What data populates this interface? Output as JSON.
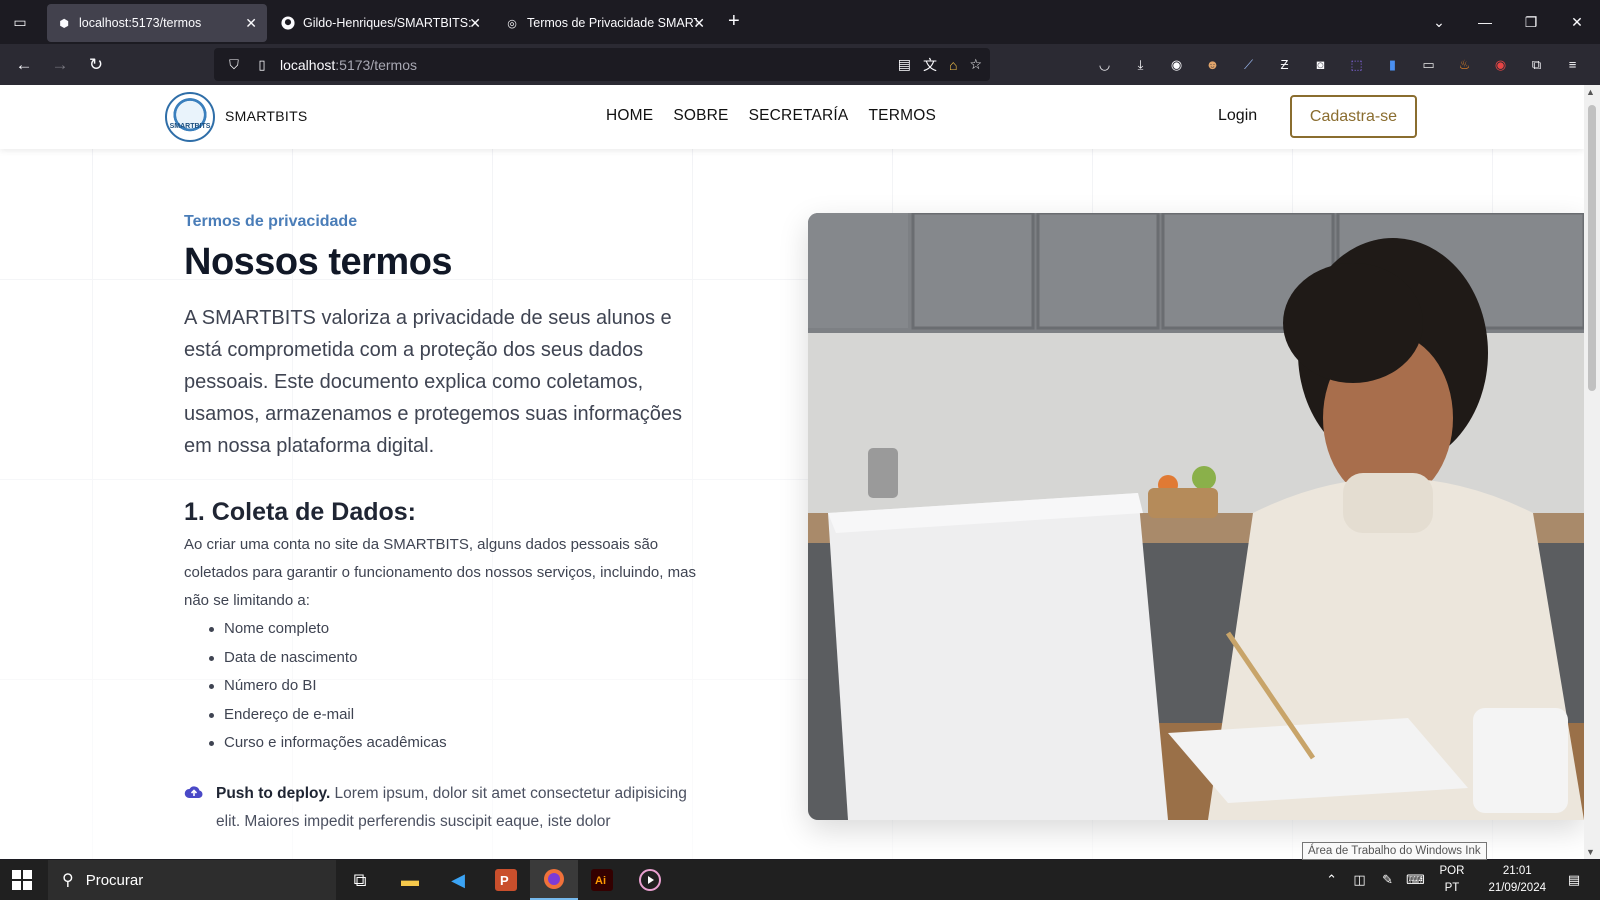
{
  "browser": {
    "tabs": [
      {
        "label": "localhost:5173/termos",
        "active": true
      },
      {
        "label": "Gildo-Henriques/SMARTBITS: P",
        "active": false
      },
      {
        "label": "Termos de Privacidade SMARTBI",
        "active": false
      }
    ],
    "url_host": "localhost",
    "url_path": ":5173/termos"
  },
  "site": {
    "brand": "SMARTBITS",
    "logo_text": "SMARTBITS",
    "nav": [
      "HOME",
      "SOBRE",
      "SECRETARÍA",
      "TERMOS"
    ],
    "login": "Login",
    "signup": "Cadastra-se"
  },
  "content": {
    "eyebrow": "Termos de privacidade",
    "title": "Nossos termos",
    "lead": "A SMARTBITS valoriza a privacidade de seus alunos e está comprometida com a proteção dos seus dados pessoais. Este documento explica como coletamos, usamos, armazenamos e protegemos suas informações em nossa plataforma digital.",
    "section_title": "1. Coleta de Dados:",
    "section_text": "Ao criar uma conta no site da SMARTBITS, alguns dados pessoais são coletados para garantir o funcionamento dos nossos serviços, incluindo, mas não se limitando a:",
    "items": [
      "Nome completo",
      "Data de nascimento",
      "Número do BI",
      "Endereço de e-mail",
      "Curso e informações acadêmicas"
    ],
    "feature_bold": "Push to deploy.",
    "feature_text": " Lorem ipsum, dolor sit amet consectetur adipisicing elit. Maiores impedit perferendis suscipit eaque, iste dolor"
  },
  "tooltip": "Área de Trabalho do Windows Ink",
  "taskbar": {
    "search_placeholder": "Procurar",
    "lang_line1": "POR",
    "lang_line2": "PT",
    "time": "21:01",
    "date": "21/09/2024"
  }
}
